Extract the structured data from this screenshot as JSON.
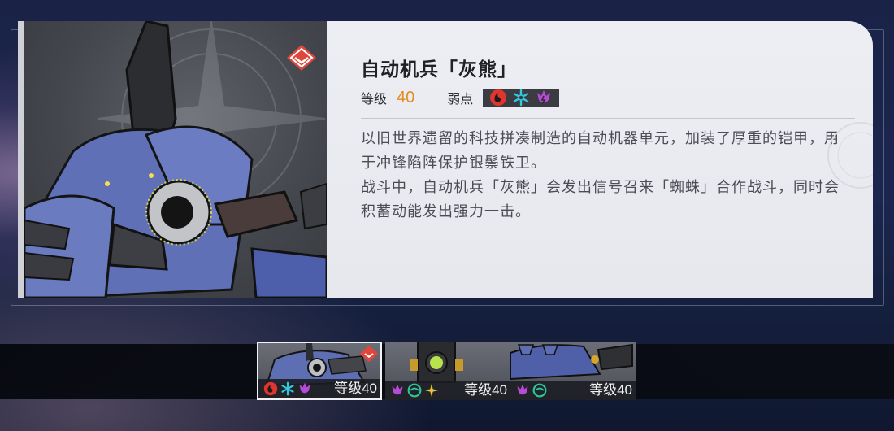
{
  "enemy": {
    "name": "自动机兵「灰熊」",
    "level_label": "等级",
    "level_value": "40",
    "weakness_label": "弱点",
    "weaknesses": [
      "fire-element-icon",
      "ice-element-icon",
      "lightning-element-icon"
    ],
    "description": [
      "以旧世界遗留的科技拼凑制造的自动机器单元，加装了厚重的铠甲，用于冲锋陷阵保护银鬃铁卫。",
      "战斗中，自动机兵「灰熊」会发出信号召来「蜘蛛」合作战斗，同时会积蓄动能发出强力一击。"
    ]
  },
  "enemy_list": [
    {
      "level_text": "等级40",
      "selected": true,
      "elements": [
        "fire-element-icon",
        "ice-element-icon",
        "lightning-element-icon"
      ],
      "elite": true
    },
    {
      "level_text": "等级40",
      "selected": false,
      "elements": [
        "lightning-element-icon",
        "wind-element-icon",
        "imaginary-element-icon"
      ],
      "elite": false
    },
    {
      "level_text": "等级40",
      "selected": false,
      "elements": [
        "lightning-element-icon",
        "wind-element-icon"
      ],
      "elite": false
    }
  ],
  "colors": {
    "level_accent": "#e48a1e",
    "fire": "#e0342f",
    "ice": "#32c8e0",
    "lightning": "#b44ad6",
    "wind": "#2fc49a",
    "imaginary": "#e8c53a"
  }
}
